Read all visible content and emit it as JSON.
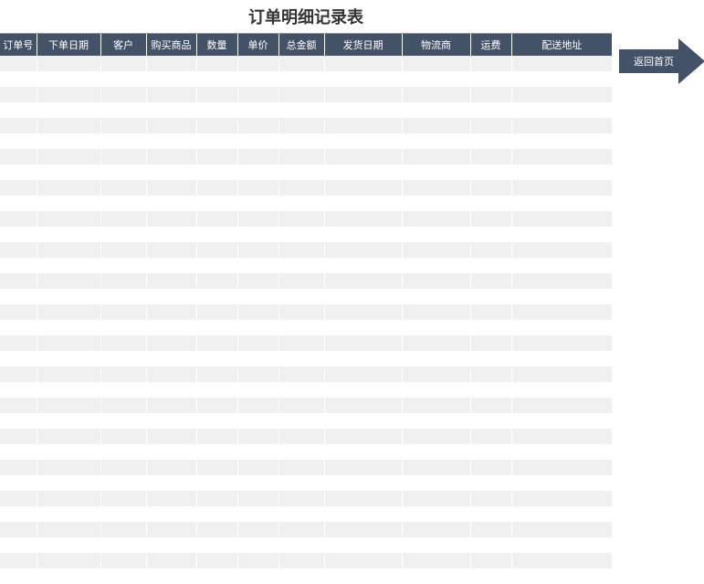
{
  "title": "订单明细记录表",
  "columns": [
    "订单号",
    "下单日期",
    "客户",
    "购买商品",
    "数量",
    "单价",
    "总金额",
    "发货日期",
    "物流商",
    "运费",
    "配送地址"
  ],
  "row_count": 34,
  "button": {
    "label": "返回首页",
    "color": "#445268"
  }
}
